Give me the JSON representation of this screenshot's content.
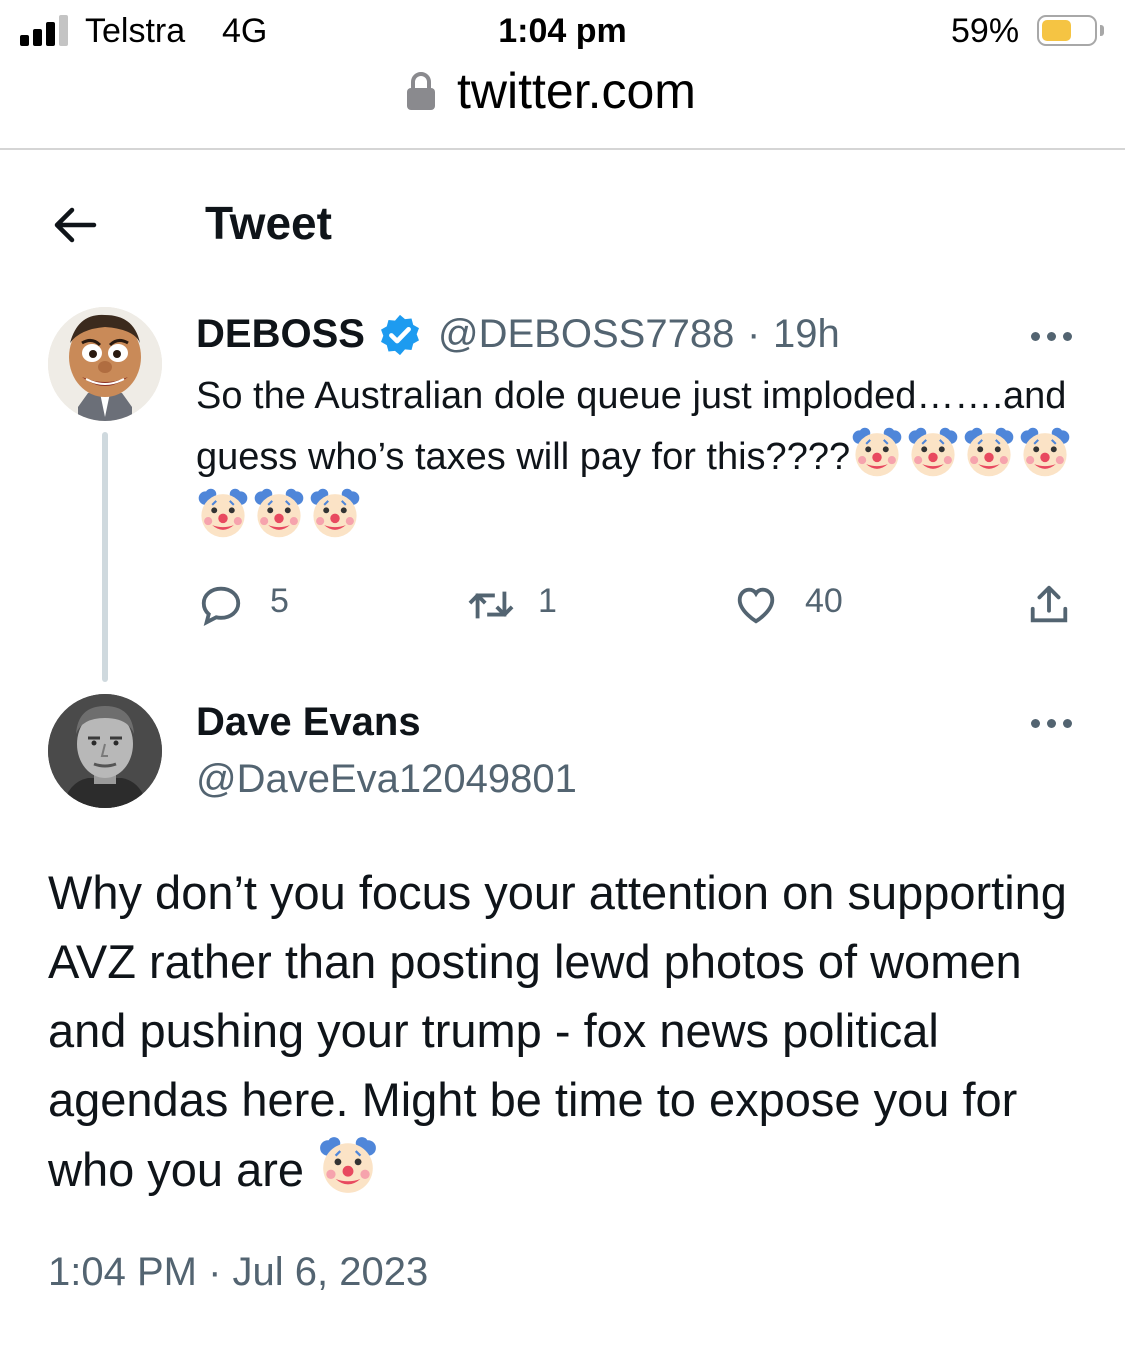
{
  "status_bar": {
    "carrier": "Telstra",
    "network": "4G",
    "time": "1:04 pm",
    "battery_percent": "59%",
    "battery_level": 0.59,
    "battery_color": "#f5c443"
  },
  "browser": {
    "url": "twitter.com"
  },
  "header": {
    "title": "Tweet",
    "back_icon": "arrow-left-icon"
  },
  "original_tweet": {
    "display_name": "DEBOSS",
    "verified": true,
    "verified_color": "#1d9bf0",
    "handle": "@DEBOSS7788",
    "separator": "·",
    "age": "19h",
    "text": "So the Australian dole queue just imploded…….and guess who’s taxes will pay for this????",
    "emojis": [
      "clown-face",
      "clown-face",
      "clown-face",
      "clown-face",
      "clown-face",
      "clown-face",
      "clown-face"
    ],
    "replies": "5",
    "retweets": "1",
    "likes": "40"
  },
  "reply_tweet": {
    "display_name": "Dave Evans",
    "handle": "@DaveEva12049801",
    "text": "Why don’t you focus your attention on supporting AVZ rather than posting lewd photos of women and pushing your trump - fox news political agendas here. Might be time to expose you for who you are",
    "emoji": "clown-face",
    "timestamp": "1:04 PM · Jul 6, 2023"
  },
  "colors": {
    "text_primary": "#0f1419",
    "text_secondary": "#536471",
    "thread_line": "#cfd9de"
  }
}
